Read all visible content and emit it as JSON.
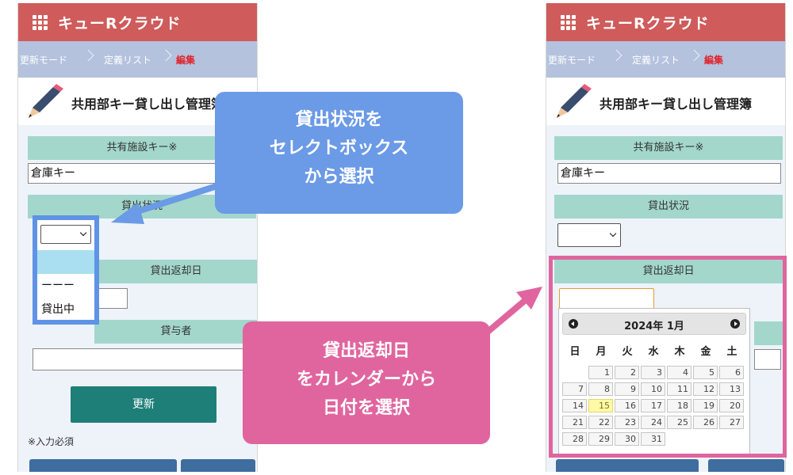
{
  "app": {
    "title": "キューRクラウド"
  },
  "breadcrumb": {
    "mode": "更新モード",
    "list": "定義リスト",
    "current": "編集"
  },
  "page": {
    "title": "共用部キー貸し出し管理簿"
  },
  "form": {
    "facility_key_label": "共有施設キー※",
    "facility_key_value": "倉庫キー",
    "status_label": "貸出状況",
    "status_options": [
      "",
      "ーーー",
      "貸出中"
    ],
    "return_date_label": "貸出返却日",
    "lender_label": "貸与者",
    "update_button": "更新",
    "required_note": "※入力必須"
  },
  "calendar": {
    "month_title": "2024年 1月",
    "weekdays": [
      "日",
      "月",
      "火",
      "水",
      "木",
      "金",
      "土"
    ],
    "today": "15",
    "weeks": [
      [
        "",
        "1",
        "2",
        "3",
        "4",
        "5",
        "6"
      ],
      [
        "7",
        "8",
        "9",
        "10",
        "11",
        "12",
        "13"
      ],
      [
        "14",
        "15",
        "16",
        "17",
        "18",
        "19",
        "20"
      ],
      [
        "21",
        "22",
        "23",
        "24",
        "25",
        "26",
        "27"
      ],
      [
        "28",
        "29",
        "30",
        "31",
        "",
        "",
        ""
      ]
    ]
  },
  "annotations": {
    "blue": [
      "貸出状況を",
      "セレクトボックス",
      "から選択"
    ],
    "pink": [
      "貸出返却日",
      "をカレンダーから",
      "日付を選択"
    ]
  },
  "colors": {
    "appbar": "#cf5b5b",
    "breadcrumb_bg": "#b4c2dd",
    "field_header": "#a3d7cb",
    "update_button": "#1e7f78",
    "callout_blue": "#6b9ae6",
    "callout_pink": "#e0659e",
    "today_highlight": "#fff9a8"
  }
}
